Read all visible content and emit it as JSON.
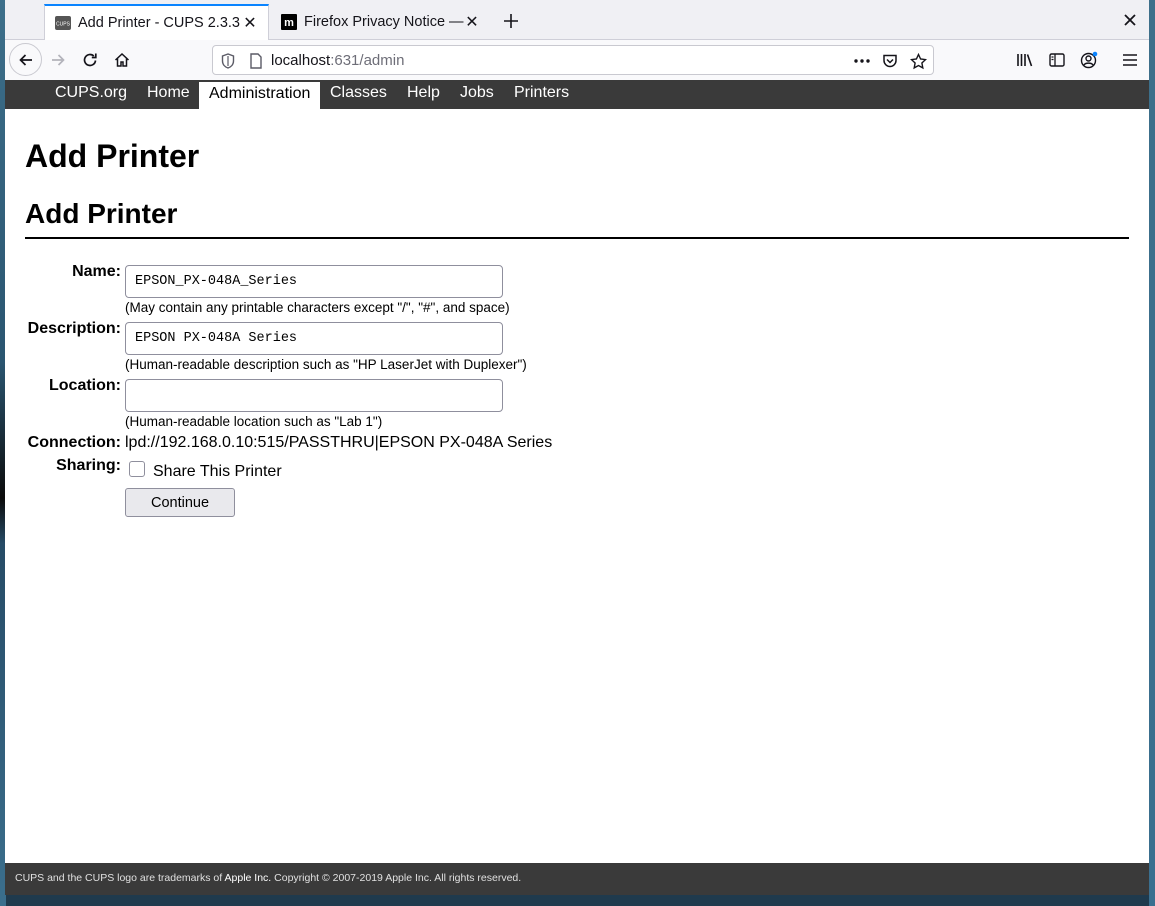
{
  "browser": {
    "tabs": [
      {
        "title": "Add Printer - CUPS 2.3.3",
        "favicon": "cups-favicon",
        "active": true
      },
      {
        "title": "Firefox Privacy Notice —",
        "favicon": "mozilla-favicon",
        "active": false
      }
    ],
    "favicon_text": {
      "cups": "CUPS",
      "mozilla": "m"
    },
    "url": {
      "host": "localhost",
      "rest": ":631/admin"
    },
    "accent_color": "#0a84ff"
  },
  "cups": {
    "nav": [
      "CUPS.org",
      "Home",
      "Administration",
      "Classes",
      "Help",
      "Jobs",
      "Printers"
    ],
    "active_nav": "Administration"
  },
  "page": {
    "title": "Add Printer",
    "section_title": "Add Printer",
    "form": {
      "name_label": "Name:",
      "name_value": "EPSON_PX-048A_Series",
      "name_hint": "(May contain any printable characters except \"/\", \"#\", and space)",
      "description_label": "Description:",
      "description_value": "EPSON PX-048A Series",
      "description_hint": "(Human-readable description such as \"HP LaserJet with Duplexer\")",
      "location_label": "Location:",
      "location_value": "",
      "location_hint": "(Human-readable location such as \"Lab 1\")",
      "connection_label": "Connection:",
      "connection_value": "lpd://192.168.0.10:515/PASSTHRU|EPSON PX-048A Series",
      "sharing_label": "Sharing:",
      "sharing_checkbox_label": "Share This Printer",
      "sharing_checked": false,
      "continue_label": "Continue"
    }
  },
  "footer": {
    "text_before": "CUPS and the CUPS logo are trademarks of ",
    "link": "Apple Inc.",
    "text_after": " Copyright © 2007-2019 Apple Inc. All rights reserved."
  }
}
